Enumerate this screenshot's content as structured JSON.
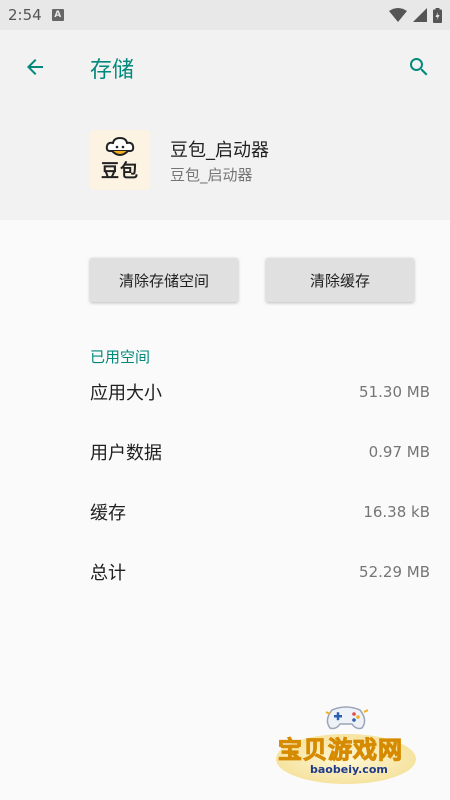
{
  "status_bar": {
    "time": "2:54",
    "notification_icon": "A"
  },
  "header": {
    "title": "存储",
    "back_icon": "arrow-left-icon",
    "search_icon": "search-icon"
  },
  "app": {
    "icon_text": "豆包",
    "name": "豆包_启动器",
    "package": "豆包_启动器"
  },
  "buttons": {
    "clear_storage": "清除存储空间",
    "clear_cache": "清除缓存"
  },
  "section": {
    "label": "已用空间"
  },
  "storage_rows": [
    {
      "label": "应用大小",
      "value": "51.30 MB"
    },
    {
      "label": "用户数据",
      "value": "0.97 MB"
    },
    {
      "label": "缓存",
      "value": "16.38 kB"
    },
    {
      "label": "总计",
      "value": "52.29 MB"
    }
  ],
  "watermark": {
    "text": "宝贝游戏网",
    "url": "baobeiy.com"
  },
  "colors": {
    "accent": "#00897b",
    "button_bg": "#e0e0e0",
    "header_bg": "#f2f2f2"
  }
}
